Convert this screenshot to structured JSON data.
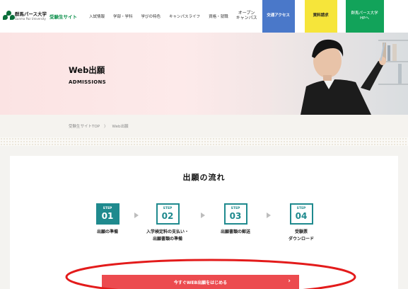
{
  "header": {
    "logo_jp": "群馬パース大学",
    "logo_en": "Gunma Paz University",
    "site_label": "受験生サイト",
    "nav": [
      "入試情報",
      "学部・学科",
      "学びの特色",
      "キャンパスライフ",
      "資格・就職"
    ],
    "open_campus_line1": "オープン",
    "open_campus_line2": "キャンパス",
    "access_label": "交通アクセス",
    "doc_request_label": "資料請求",
    "univ_line1": "群馬パース大学",
    "univ_line2": "HPへ"
  },
  "hero": {
    "title": "Web出願",
    "subtitle": "ADMISSIONS"
  },
  "breadcrumb": {
    "home": "受験生サイトTOP",
    "separator": "〉",
    "current": "Web出願"
  },
  "flow": {
    "title": "出願の流れ",
    "step_prefix": "STEP",
    "steps": [
      {
        "num": "01",
        "line1": "出願の準備",
        "line2": "",
        "active": true
      },
      {
        "num": "02",
        "line1": "入学検定料の支払い・",
        "line2": "出願書類の準備",
        "active": false
      },
      {
        "num": "03",
        "line1": "出願書類の郵送",
        "line2": "",
        "active": false
      },
      {
        "num": "04",
        "line1": "受験票",
        "line2": "ダウンロード",
        "active": false
      }
    ]
  },
  "cta": {
    "label": "今すぐWEB出願をはじめる",
    "chevron": "›"
  },
  "colors": {
    "teal": "#1f8a8e",
    "cta_red": "#ec4b4f",
    "annotation_red": "#e31b1b",
    "access_blue": "#4a78c9",
    "doc_yellow": "#f6e53a",
    "univ_green": "#12a35a"
  }
}
